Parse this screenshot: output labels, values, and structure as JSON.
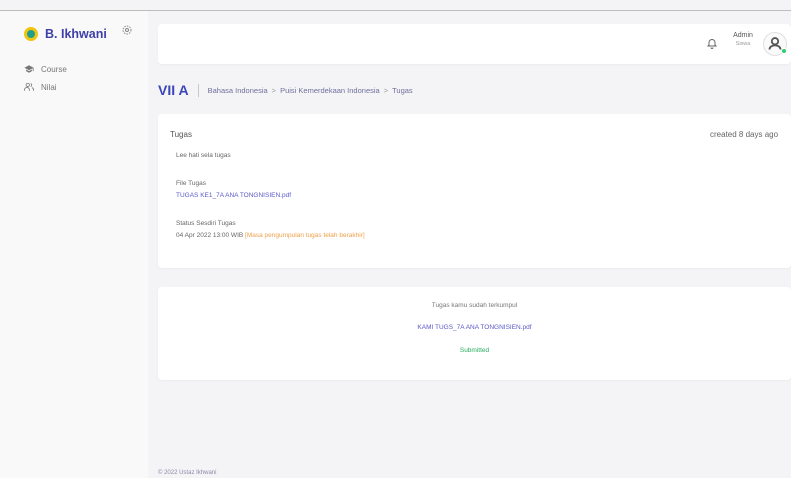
{
  "brand": {
    "name": "B. Ikhwani"
  },
  "sidebar": {
    "items": [
      {
        "label": "Course",
        "icon": "graduation-cap-icon"
      },
      {
        "label": "Nilai",
        "icon": "users-icon"
      }
    ]
  },
  "header": {
    "user_name": "Admin",
    "user_role": "Siswa"
  },
  "breadcrumb": {
    "class_title": "VII A",
    "items": [
      "Bahasa Indonesia",
      "Puisi Kemerdekaan Indonesia",
      "Tugas"
    ],
    "separator": ">"
  },
  "task": {
    "title": "Tugas",
    "created": "created 8 days ago",
    "description": "Lee hati sela tugas",
    "file_label": "File Tugas",
    "file_name": "TUGAS KE1_7A ANA TONGNISIEN.pdf",
    "status_label": "Status Sesdiri Tugas",
    "deadline": "04 Apr 2022 13:00 WIB",
    "deadline_warning": "[Masa pengumpulan tugas telah berakhir]"
  },
  "submission": {
    "label": "Tugas kamu sudah terkumpul",
    "file_name": "KAMI TUGS_7A ANA TONGNISIEN.pdf",
    "status": "Submitted"
  },
  "footer": {
    "text": "© 2022 Ustaz Ikhwani"
  },
  "colors": {
    "brand": "#3f3fa9",
    "link": "#5a58c9",
    "warning": "#f0a04b",
    "success": "#27ae60",
    "online": "#2ecc71"
  }
}
